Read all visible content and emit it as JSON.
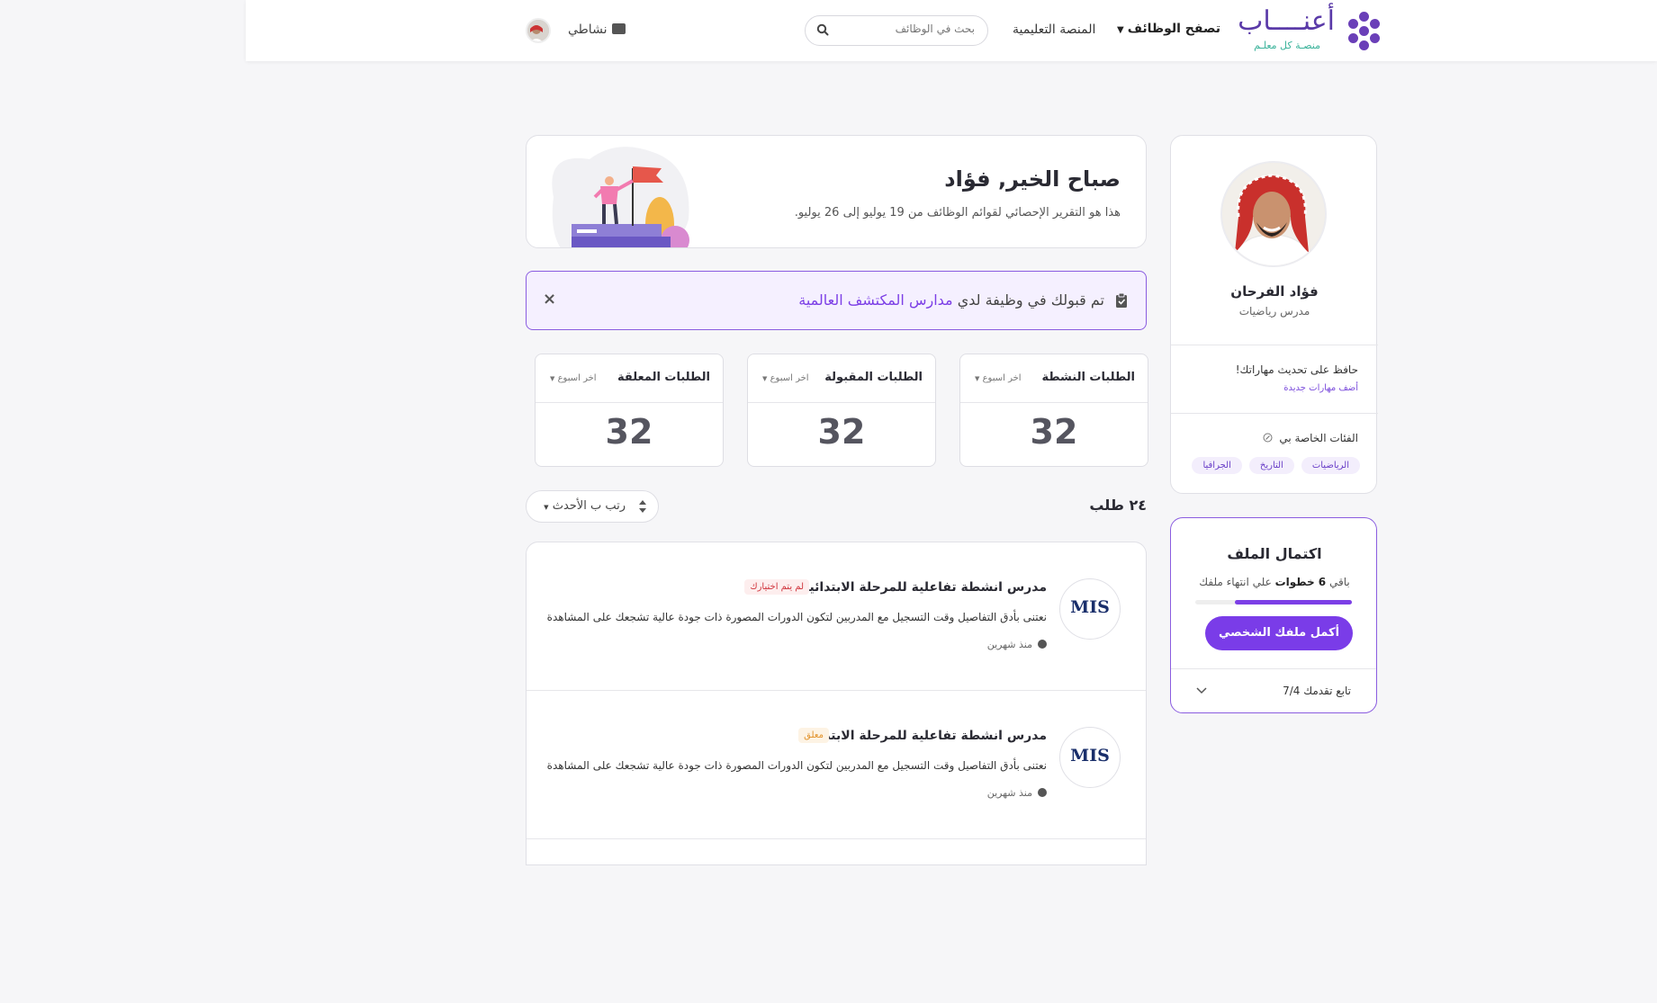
{
  "header": {
    "logo_text": "أعنــــاب",
    "logo_tagline": "منصـة كل معلـم",
    "nav_browse_jobs": "تصفح الوظائف",
    "nav_edu_platform": "المنصة التعليمية",
    "search_placeholder": "بحث في الوظائف",
    "activity_label": "نشاطي"
  },
  "profile": {
    "name": "فؤاد الفرحان",
    "title": "مدرس رياضيات",
    "skills_message": "حافظ على تحديث مهاراتك!",
    "skills_link": "أضف مهارات جديدة",
    "categories_title": "الفئات الخاصة بي",
    "categories": [
      "الرياضيات",
      "التاريخ",
      "الجرافيا"
    ]
  },
  "completion": {
    "title": "اكتمال الملف",
    "remaining_prefix": "باقي",
    "remaining_steps": "6 خطوات",
    "remaining_suffix": "علي انتهاء ملفك",
    "progress_fraction": 0.75,
    "button_label": "أكمل ملفك الشخصي",
    "follow_label": "تابع تقدمك 7/4"
  },
  "welcome": {
    "title": "صباح الخير, فؤاد",
    "subtitle": "هذا هو التقرير الإحصائي لقوائم الوظائف من 19 يوليو إلى 26 يوليو."
  },
  "notice": {
    "prefix": "تم قبولك في وظيفة لدي",
    "company": "مدارس المكتشف العالمية",
    "close": "×"
  },
  "stats": [
    {
      "title": "الطلبات النشطة",
      "period": "اخر اسبوع",
      "value": "32"
    },
    {
      "title": "الطلبات المقبولة",
      "period": "اخر اسبوع",
      "value": "32"
    },
    {
      "title": "الطلبات المعلقة",
      "period": "اخر اسبوع",
      "value": "32"
    }
  ],
  "results": {
    "count_label": "٢٤ طلب",
    "sort_label": "رتب ب الأحدث"
  },
  "jobs": [
    {
      "title": "مدرس انشطة تفاعلية للمرحلة الابتدائية",
      "badge": "لم يتم اختيارك",
      "badge_color": "#d0343c",
      "description": "نعتنى بأدق التفاصيل وقت التسجيل مع المدربين لتكون الدورات المصورة ذات جودة عالية تشجعك على المشاهدة",
      "time": "منذ شهرين",
      "logo_text": "MIS"
    },
    {
      "title": "مدرس انشطة تفاعلية للمرحلة الابتدائية",
      "badge": "معلق",
      "badge_color": "#e2922a",
      "description": "نعتنى بأدق التفاصيل وقت التسجيل مع المدربين لتكون الدورات المصورة ذات جودة عالية تشجعك على المشاهدة",
      "time": "منذ شهرين",
      "logo_text": "MIS"
    }
  ],
  "colors": {
    "brand_purple": "#7a3ce8",
    "accent_teal": "#3bb39b"
  }
}
